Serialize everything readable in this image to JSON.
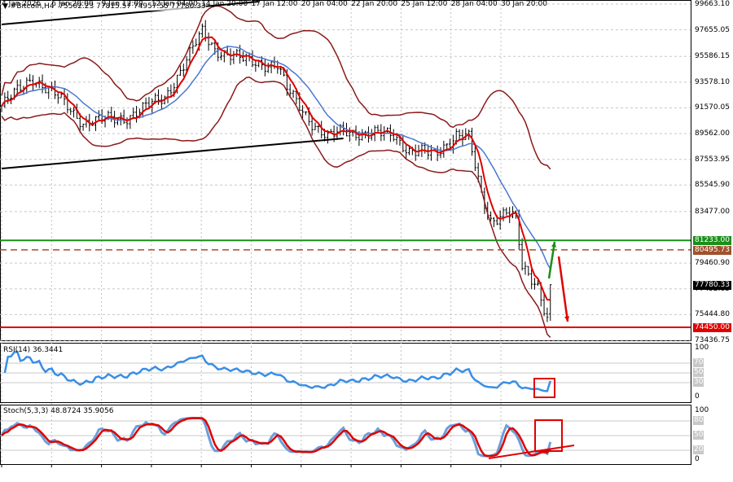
{
  "header": {
    "symbol": "#Bitcoin,H4",
    "ohlc": "75502.23 77815.57 74957.55 77780.33",
    "menu_icon": "triangle-down-icon"
  },
  "price_axis": [
    "99663.10",
    "97655.05",
    "95586.15",
    "93578.10",
    "91570.05",
    "89562.00",
    "87553.95",
    "85545.90",
    "83477.00",
    "79460.90",
    "77452.85",
    "75444.80",
    "73436.75"
  ],
  "price_range": [
    73436.75,
    99663.1
  ],
  "levels": [
    {
      "label": "81233.00",
      "price": 81233.0,
      "color": "#1a8f1a",
      "style": "solid"
    },
    {
      "label": "80495.73",
      "price": 80495.73,
      "color": "#a0522d",
      "style": "dashed"
    },
    {
      "label": "77780.33",
      "price": 77780.33,
      "color": "#000000",
      "style": "current"
    },
    {
      "label": "74450.00",
      "price": 74450.0,
      "color": "#e00000",
      "style": "solid"
    }
  ],
  "time_axis": [
    "4 Jan 2026",
    "6 Jan 20:00",
    "9 Jan 12:00",
    "12 Jan 04:00",
    "14 Jan 20:00",
    "17 Jan 12:00",
    "20 Jan 04:00",
    "22 Jan 20:00",
    "25 Jan 12:00",
    "28 Jan 04:00",
    "30 Jan 20:00"
  ],
  "rsi": {
    "title": "RSI(14) 36.3441",
    "levels": [
      "100",
      "70",
      "50",
      "30",
      "0"
    ],
    "color": "#3a8ee6"
  },
  "stoch": {
    "title": "Stoch(5,3,3) 48.8724 35.9056",
    "levels": [
      "100",
      "80",
      "50",
      "20",
      "0"
    ],
    "k_color": "#6a9fdb",
    "d_color": "#e00000"
  },
  "chart_data": {
    "type": "ohlc",
    "timeframe": "H4",
    "start": "2026-01-04 00:00",
    "close_keypoints": [
      [
        "2026-01-04 00:00",
        91725
      ],
      [
        "2026-01-05 16:00",
        93950
      ],
      [
        "2026-01-07 00:00",
        92360
      ],
      [
        "2026-01-08 08:00",
        90455
      ],
      [
        "2026-01-10 12:00",
        90770
      ],
      [
        "2026-01-12 16:00",
        92360
      ],
      [
        "2026-01-14 16:00",
        97440
      ],
      [
        "2026-01-15 08:00",
        96170
      ],
      [
        "2026-01-17 00:00",
        95220
      ],
      [
        "2026-01-18 16:00",
        94900
      ],
      [
        "2026-01-19 04:00",
        93000
      ],
      [
        "2026-01-20 12:00",
        90455
      ],
      [
        "2026-01-21 08:00",
        89185
      ],
      [
        "2026-01-22 04:00",
        89820
      ],
      [
        "2026-01-23 12:00",
        89500
      ],
      [
        "2026-01-24 20:00",
        89500
      ],
      [
        "2026-01-25 16:00",
        88230
      ],
      [
        "2026-01-27 00:00",
        87910
      ],
      [
        "2026-01-28 04:00",
        89500
      ],
      [
        "2026-01-28 20:00",
        89185
      ],
      [
        "2026-01-29 12:00",
        84740
      ],
      [
        "2026-01-30 00:00",
        82840
      ],
      [
        "2026-01-30 20:00",
        83470
      ],
      [
        "2026-01-31 08:00",
        82840
      ],
      [
        "2026-01-31 16:00",
        79030
      ],
      [
        "2026-02-01 12:00",
        77750
      ],
      [
        "2026-02-02 00:00",
        75210
      ],
      [
        "2026-02-02 04:00",
        77780
      ]
    ],
    "last_bar": {
      "open": 75502.23,
      "high": 77815.57,
      "low": 74957.55,
      "close": 77780.33
    },
    "trendlines": [
      {
        "color": "#000000",
        "points": [
          [
            "2026-01-04 00:00",
            98076
          ],
          [
            "2026-01-17 16:00",
            99854
          ]
        ]
      },
      {
        "color": "#000000",
        "points": [
          [
            "2026-01-04 00:00",
            86837
          ],
          [
            "2026-01-22 04:00",
            89185
          ]
        ]
      }
    ],
    "indicators": {
      "bollinger": {
        "period": 20,
        "deviation": 2,
        "color": "#8b1a1a"
      },
      "ma_fast_color": "#e00000",
      "ma_slow_color": "#4a78d0"
    },
    "arrows": [
      {
        "direction": "up",
        "color": "#1a8f1a"
      },
      {
        "direction": "down",
        "color": "#e00000"
      }
    ]
  }
}
